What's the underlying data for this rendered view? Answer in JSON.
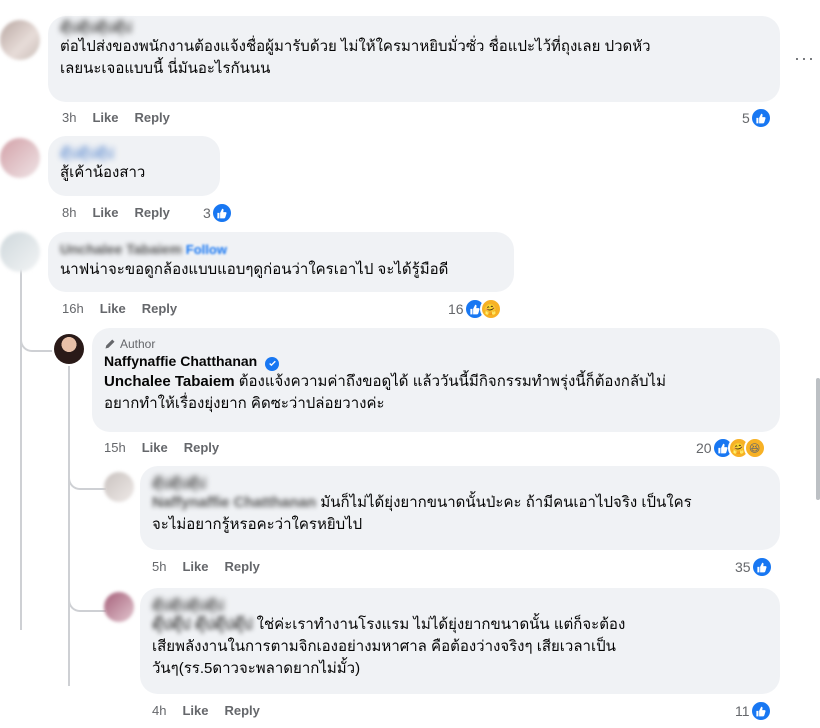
{
  "comments": [
    {
      "name": "ดุ๊ปดุ๊ปดุ๊ปดุ๊ป",
      "text_line1": "ต่อไปส่งของพนักงานต้องแจ้งชื่อผู้มารับด้วย ไม่ให้ใครมาหยิบมั่วซั่ว ชื่อแปะไว้ที่ถุงเลย ปวดหัว",
      "text_line2": "เลยนะเจอแบบนี้ นี่มันอะไรกันนน",
      "time": "3h",
      "like": "Like",
      "reply": "Reply",
      "reactions": "5"
    },
    {
      "name": "ดุ๊ปดุ๊ปดุ๊ป",
      "text_line1": "สู้เค้าน้องสาว",
      "time": "8h",
      "like": "Like",
      "reply": "Reply",
      "reactions": "3"
    },
    {
      "name": "Unchalee Tabaiem",
      "follow": "Follow",
      "text_line1": "นาฟน่าจะขอดูกล้องแบบแอบๆดูก่อนว่าใครเอาไป จะได้รู้มือดี",
      "time": "16h",
      "like": "Like",
      "reply": "Reply",
      "reactions": "16"
    },
    {
      "author_tag": "Author",
      "name": "Naffynaffie Chatthanan",
      "mention": "Unchalee Tabaiem",
      "text_line1": " ต้องแจ้งความค่าถึงขอดูได้ แล้ววันนี้มีกิจกรรมทำพรุ่งนี้ก็ต้องกลับไม่",
      "text_line2": "อยากทำให้เรื่องยุ่งยาก คิดซะว่าปล่อยวางค่ะ",
      "time": "15h",
      "like": "Like",
      "reply": "Reply",
      "reactions": "20"
    },
    {
      "name": "ดุ๊ปดุ๊ปดุ๊ป",
      "mention": "Naffynaffie Chatthanan",
      "text_line1": " มันก็ไม่ได้ยุ่งยากขนาดนั้นป่ะคะ ถ้ามีคนเอาไปจริง เป็นใคร",
      "text_line2": "จะไม่อยากรู้หรอคะว่าใครหยิบไป",
      "time": "5h",
      "like": "Like",
      "reply": "Reply",
      "reactions": "35"
    },
    {
      "name": "ดุ๊ปดุ๊ปดุ๊ปดุ๊ป",
      "mention": "ดุ๊ปดุ๊ป ดุ๊ปดุ๊ปดุ๊ป",
      "text_line1": " ใช่ค่ะเราทำงานโรงแรม ไม่ได้ยุ่งยากขนาดนั้น แต่ก็จะต้อง",
      "text_line2": "เสียพลังงานในการตามจิกเองอย่างมหาศาล คือต้องว่างจริงๆ เสียเวลาเป็น",
      "text_line3": "วันๆ(รร.5ดาวจะพลาดยากไม่มั้ว)",
      "time": "4h",
      "like": "Like",
      "reply": "Reply",
      "reactions": "11"
    }
  ],
  "more_options": "···",
  "colors": {
    "bubble": "#f0f2f5",
    "meta": "#65676b",
    "link": "#1877f2",
    "line": "#ced0d4"
  }
}
